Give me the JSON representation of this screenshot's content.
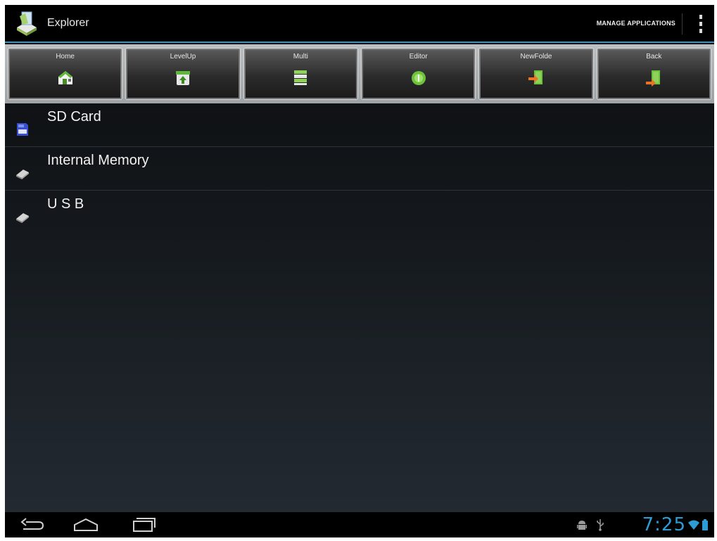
{
  "app": {
    "title": "Explorer",
    "manage_label": "MANAGE APPLICATIONS"
  },
  "toolbar": {
    "buttons": [
      {
        "label": "Home",
        "icon": "home-icon"
      },
      {
        "label": "LevelUp",
        "icon": "level-up-icon"
      },
      {
        "label": "Multi",
        "icon": "multi-select-icon"
      },
      {
        "label": "Editor",
        "icon": "editor-icon"
      },
      {
        "label": "NewFolde",
        "icon": "new-folder-icon"
      },
      {
        "label": "Back",
        "icon": "back-icon"
      }
    ]
  },
  "storage": {
    "items": [
      {
        "label": "SD Card",
        "icon": "sd-card-icon"
      },
      {
        "label": "Internal Memory",
        "icon": "drive-icon"
      },
      {
        "label": "U S B",
        "icon": "drive-icon"
      }
    ]
  },
  "status": {
    "clock": "7:25"
  },
  "colors": {
    "accent": "#2b94c9",
    "clock": "#2d9bd4"
  }
}
